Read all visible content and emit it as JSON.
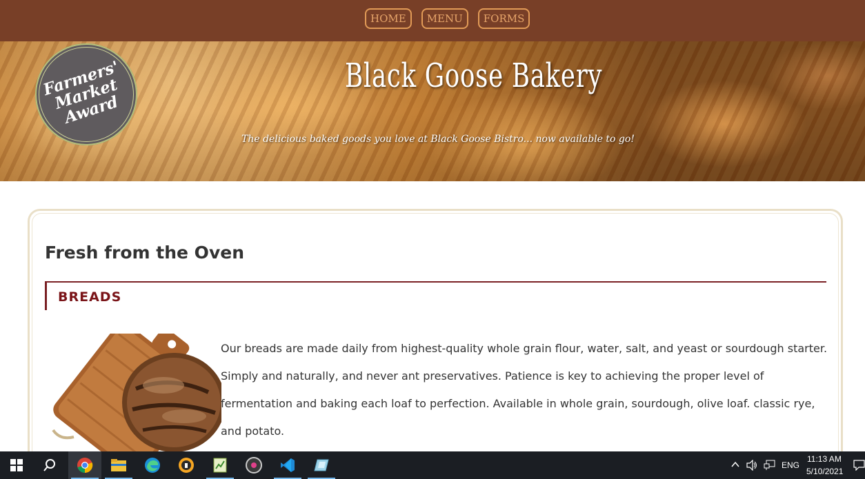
{
  "nav": {
    "items": [
      "HOME",
      "MENU",
      "FORMS"
    ]
  },
  "hero": {
    "title": "Black Goose Bakery",
    "tagline": "The delicious baked goods you love at Black Goose Bistro... now available to go!",
    "award": {
      "line1": "Farmers'",
      "line2": "Market",
      "line3": "Award"
    }
  },
  "content": {
    "heading": "Fresh from the Oven",
    "section_title": "BREADS",
    "body": "Our breads are made daily from highest-quality whole grain flour, water, salt, and yeast or sourdough starter. Simply and naturally, and never ant preservatives. Patience is key to achieving the proper level of fermentation and baking each loaf to perfection. Available in whole grain, sourdough, olive loaf. classic rye, and potato."
  },
  "taskbar": {
    "apps": [
      "start-icon",
      "search-icon",
      "chrome-icon",
      "file-explorer-icon",
      "edge-icon",
      "vpn-icon",
      "notepad-icon",
      "media-icon",
      "vscode-icon",
      "app-icon"
    ],
    "tray": {
      "language": "ENG",
      "time": "11:13 AM",
      "date": "5/10/2021"
    }
  },
  "colors": {
    "nav_bg": "#783f27",
    "nav_accent": "#e29b57",
    "section_accent": "#7a1418"
  }
}
